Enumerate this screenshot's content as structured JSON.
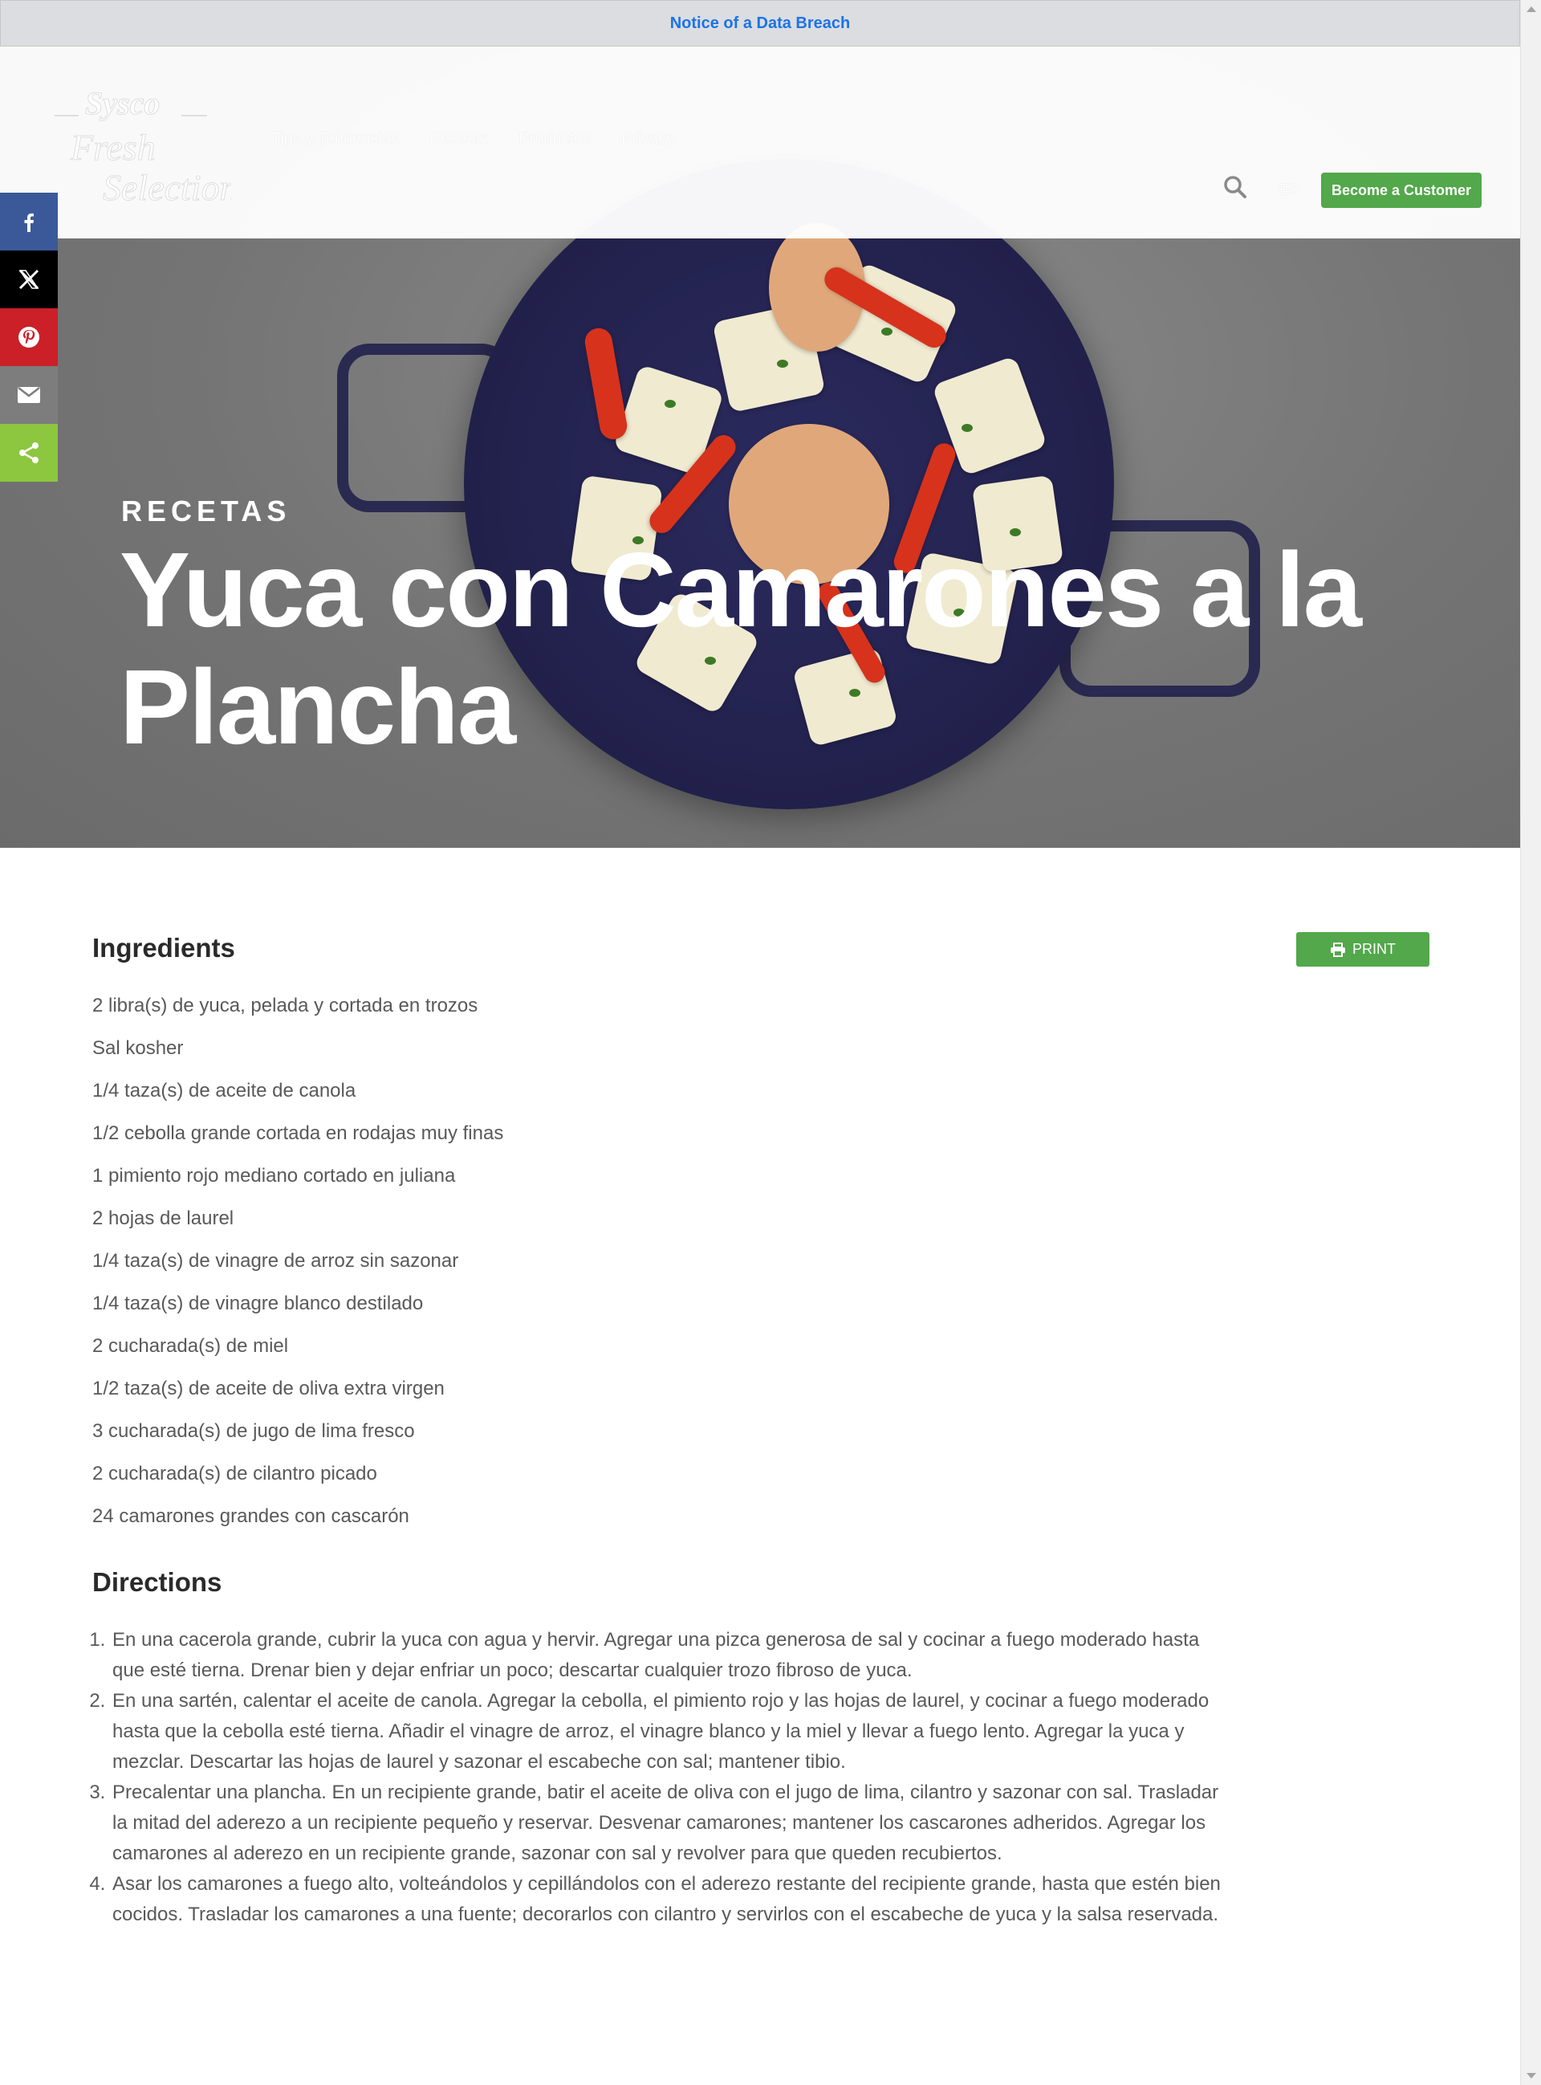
{
  "notice": {
    "link": "Notice of a Data Breach"
  },
  "header": {
    "logo_top": "Sysco",
    "logo_bottom": "Fresh Selection",
    "nav": [
      "Tips y Tendencias",
      "Recetas",
      "Productos",
      "Privacy"
    ],
    "search_icon": "search-icon",
    "language": "ES",
    "become_customer": "Become a Customer"
  },
  "share": [
    "facebook-icon",
    "x-icon",
    "pinterest-icon",
    "email-icon",
    "share-icon"
  ],
  "hero": {
    "kicker": "RECETAS",
    "title": "Yuca con Camarones a la Plancha"
  },
  "ingredients": {
    "heading": "Ingredients",
    "print": "PRINT",
    "items": [
      "2 libra(s) de yuca, pelada y cortada en trozos",
      "Sal kosher",
      "1/4 taza(s) de aceite de canola",
      "1/2 cebolla grande cortada en rodajas muy finas",
      "1 pimiento rojo mediano cortado en juliana",
      "2 hojas de laurel",
      "1/4 taza(s) de vinagre de arroz sin sazonar",
      "1/4 taza(s) de vinagre blanco destilado",
      "2 cucharada(s) de miel",
      "1/2 taza(s) de aceite de oliva extra virgen",
      "3 cucharada(s) de jugo de lima fresco",
      "2 cucharada(s) de cilantro picado",
      "24 camarones grandes con cascarón"
    ]
  },
  "directions": {
    "heading": "Directions",
    "steps": [
      "En una cacerola grande, cubrir la yuca con agua y hervir. Agregar una pizca generosa de sal y cocinar a fuego moderado hasta que esté tierna. Drenar bien y dejar enfriar un poco; descartar cualquier trozo fibroso de yuca.",
      "En una sartén, calentar el aceite de canola. Agregar la cebolla, el pimiento rojo y las hojas de laurel, y cocinar a fuego moderado hasta que la cebolla esté tierna. Añadir el vinagre de arroz, el vinagre blanco y la miel y llevar a fuego lento. Agregar la yuca y mezclar. Descartar las hojas de laurel y sazonar el escabeche con sal; mantener tibio.",
      "Precalentar una plancha. En un recipiente grande, batir el aceite de oliva con el jugo de lima,  cilantro y sazonar con sal. Trasladar la mitad del aderezo a un recipiente pequeño y reservar. Desvenar camarones; mantener los cascarones adheridos. Agregar los camarones al aderezo en un recipiente grande, sazonar con sal y revolver para que queden recubiertos.",
      "Asar los camarones a fuego alto, volteándolos y cepillándolos con el aderezo restante del recipiente grande, hasta que estén bien cocidos. Trasladar los camarones a una fuente; decorarlos con cilantro y servirlos con el escabeche de yuca y la salsa reservada."
    ]
  },
  "colors": {
    "accent_green": "#52a84a",
    "link_blue": "#1a73e8"
  }
}
